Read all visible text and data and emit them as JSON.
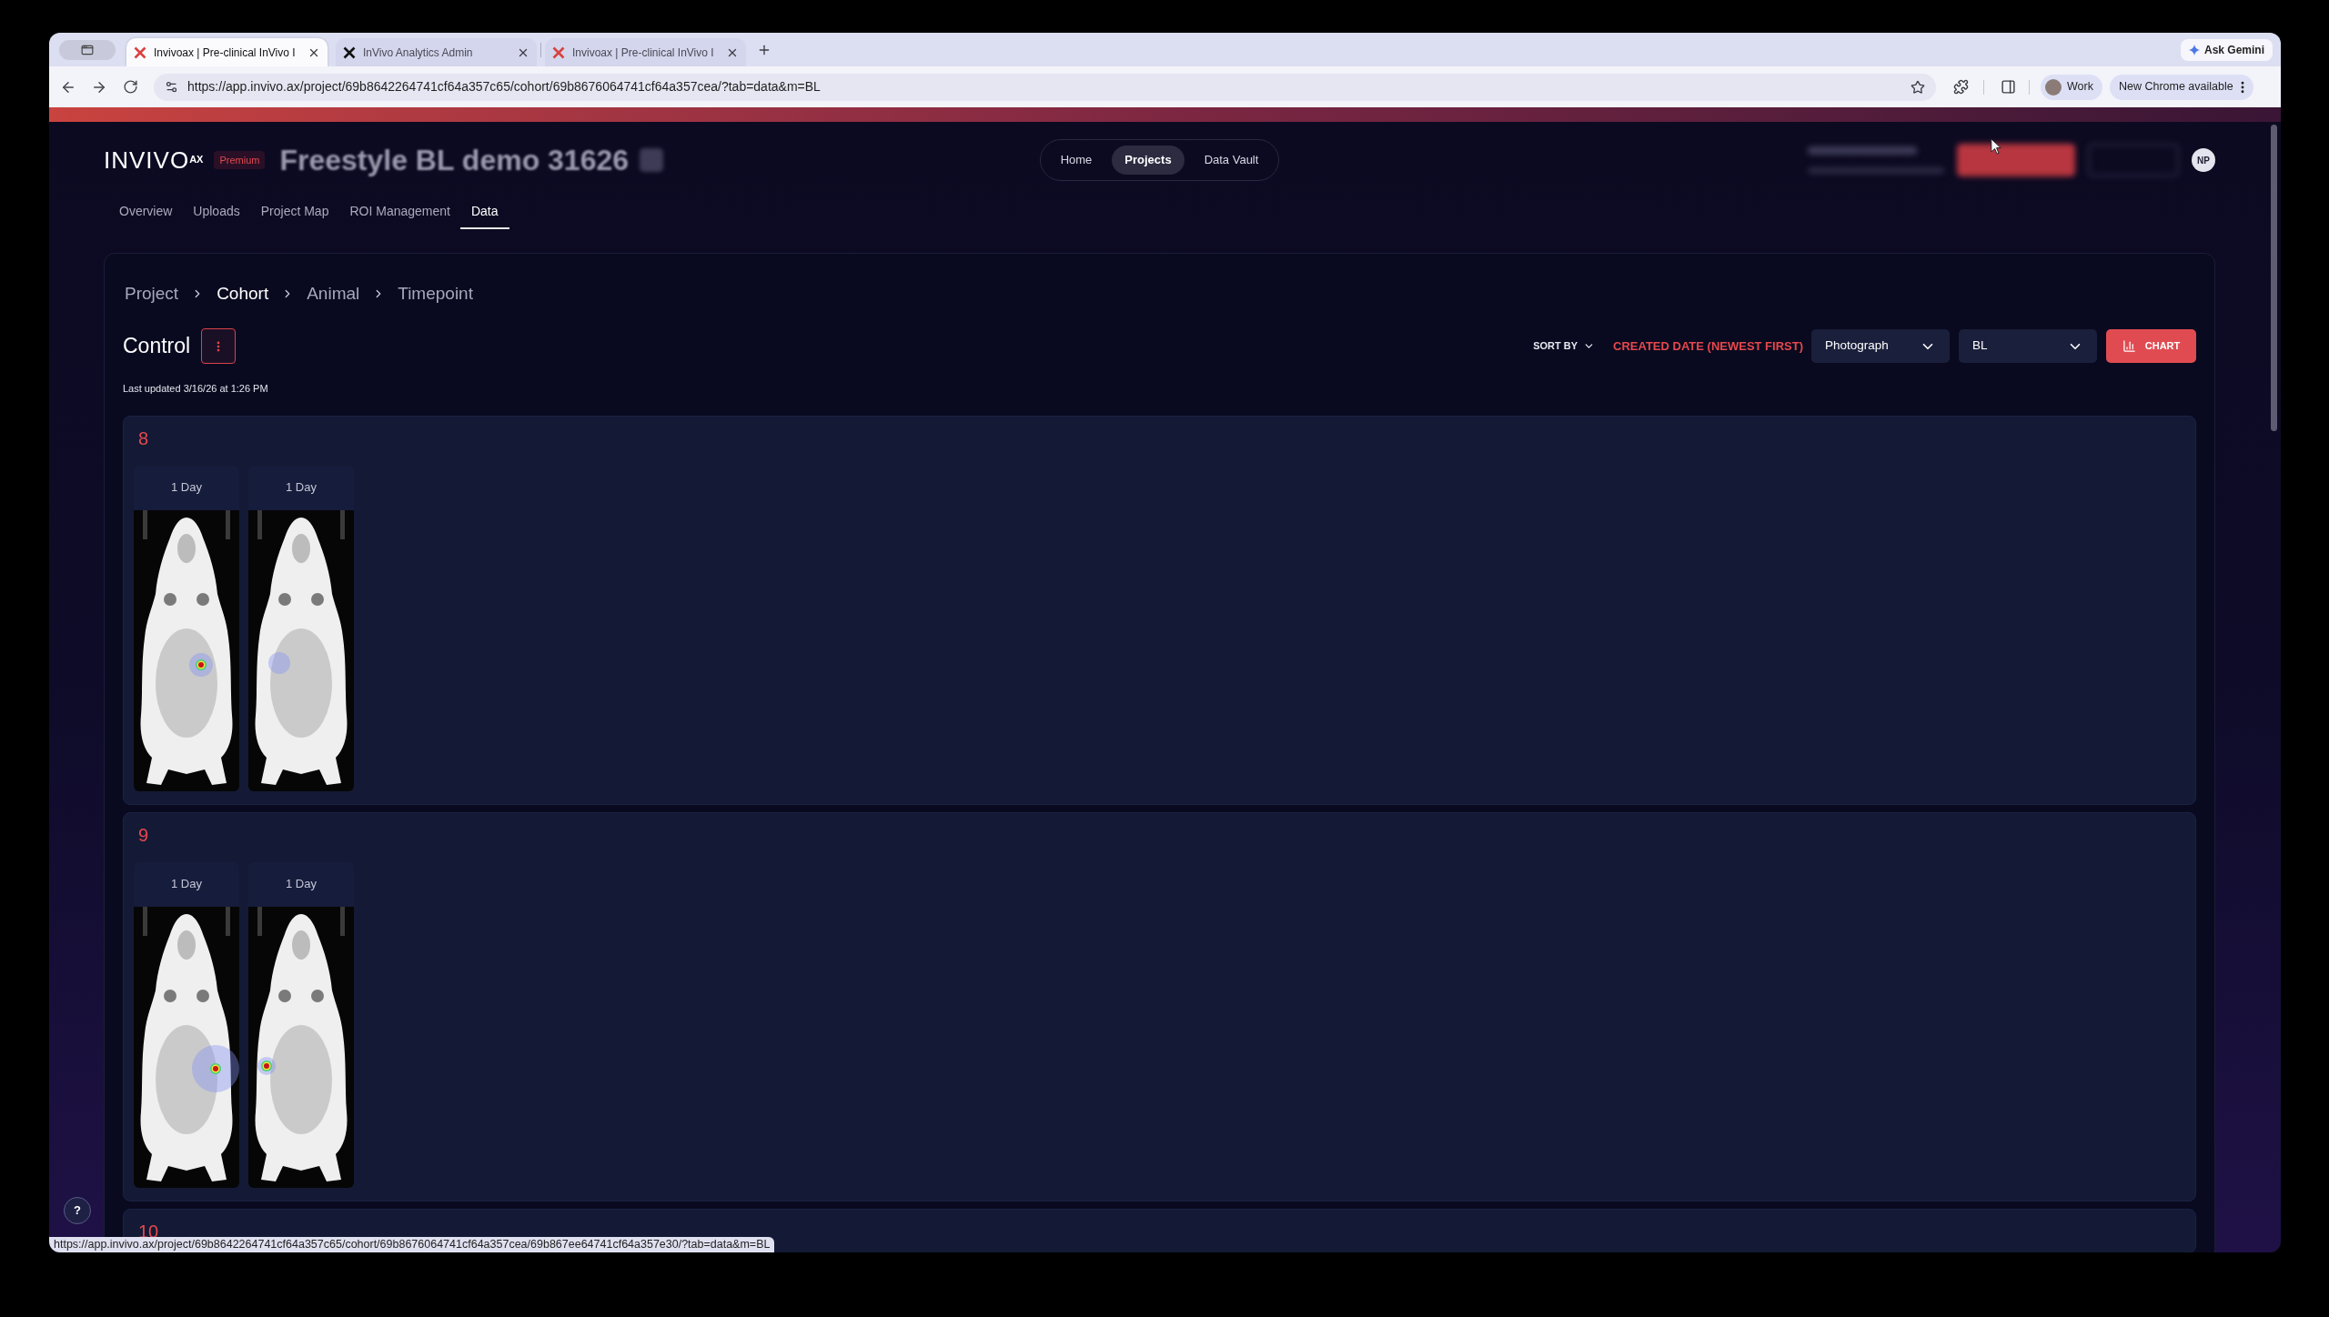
{
  "browser": {
    "tabs": [
      {
        "title": "Invivoax | Pre-clinical InVivo I",
        "color": "#d9413f",
        "selected": true
      },
      {
        "title": "InVivo Analytics Admin",
        "color": "#111111",
        "selected": false
      },
      {
        "title": "Invivoax | Pre-clinical InVivo I",
        "color": "#d9413f",
        "selected": false
      }
    ],
    "gemini": "Ask Gemini",
    "url": "https://app.invivo.ax/project/69b8642264741cf64a357c65/cohort/69b8676064741cf64a357cea/?tab=data&m=BL",
    "profile": "Work",
    "update": "New Chrome available"
  },
  "header": {
    "logo": "INVIVO$^{AX}$",
    "badge": "Premium",
    "project_title": "Freestyle BL demo 31626",
    "nav": [
      {
        "label": "Home",
        "selected": false
      },
      {
        "label": "Projects",
        "selected": true
      },
      {
        "label": "Data Vault",
        "selected": false
      }
    ],
    "avatar": "NP",
    "tabs": [
      {
        "label": "Overview",
        "selected": false
      },
      {
        "label": "Uploads",
        "selected": false
      },
      {
        "label": "Project Map",
        "selected": false
      },
      {
        "label": "ROI Management",
        "selected": false
      },
      {
        "label": "Data",
        "selected": true
      }
    ]
  },
  "breadcrumb": [
    {
      "label": "Project",
      "selected": false
    },
    {
      "label": "Cohort",
      "selected": true
    },
    {
      "label": "Animal",
      "selected": false
    },
    {
      "label": "Timepoint",
      "selected": false
    }
  ],
  "cohort": {
    "title": "Control",
    "last_updated": "Last updated 3/16/26 at 1:26 PM"
  },
  "toolbar": {
    "sort_label": "SORT BY",
    "sort_value": "CREATED DATE (NEWEST FIRST)",
    "selects": [
      {
        "value": "Photograph"
      },
      {
        "value": "BL"
      }
    ],
    "chart_button": "CHART"
  },
  "animals": [
    {
      "name": "8",
      "images": [
        {
          "label": "1 Day"
        },
        {
          "label": "1 Day"
        }
      ]
    },
    {
      "name": "9",
      "images": [
        {
          "label": "1 Day"
        },
        {
          "label": "1 Day"
        }
      ]
    },
    {
      "name": "10"
    }
  ],
  "help": "?",
  "status_url": "https://app.invivo.ax/project/69b8642264741cf64a357c65/cohort/69b8676064741cf64a357cea/69b867ee64741cf64a357e30/?tab=data&m=BL"
}
